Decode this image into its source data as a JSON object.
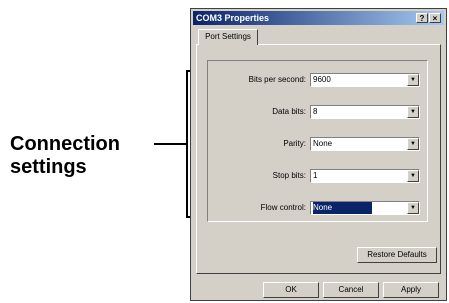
{
  "annotation": {
    "line1": "Connection",
    "line2": "settings"
  },
  "dialog": {
    "title": "COM3 Properties",
    "help_glyph": "?",
    "close_glyph": "×",
    "tab_label": "Port Settings"
  },
  "fields": [
    {
      "label": "Bits per second:",
      "value": "9600"
    },
    {
      "label": "Data bits:",
      "value": "8"
    },
    {
      "label": "Parity:",
      "value": "None"
    },
    {
      "label": "Stop bits:",
      "value": "1"
    },
    {
      "label": "Flow control:",
      "value": "None"
    }
  ],
  "buttons": {
    "restore": "Restore Defaults",
    "ok": "OK",
    "cancel": "Cancel",
    "apply": "Apply"
  },
  "colors": {
    "titlebar_start": "#0a246a",
    "titlebar_end": "#a6caf0",
    "face": "#d4d0c8",
    "selection": "#0a246a"
  },
  "icons": {
    "dropdown": "chevron-down-icon"
  }
}
